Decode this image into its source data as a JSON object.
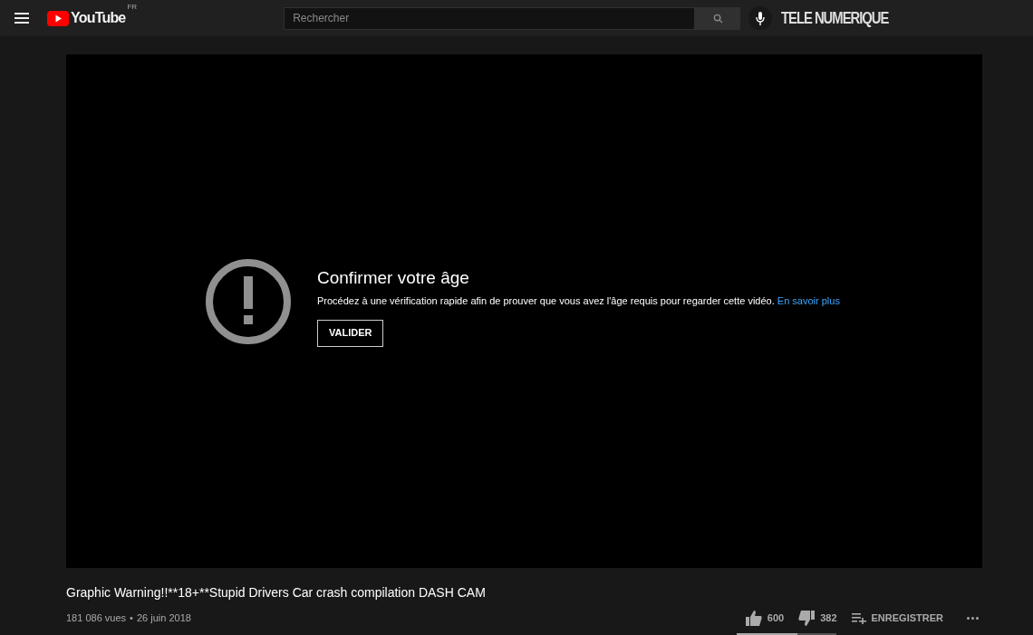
{
  "header": {
    "logo": "YouTube",
    "region": "FR",
    "search": {
      "placeholder": "Rechercher"
    },
    "channel_logo": "TELE NUMERIQUE"
  },
  "player": {
    "title": "Confirmer votre âge",
    "message": "Procédez à une vérification rapide afin de prouver que vous avez l'âge requis pour regarder cette vidéo.",
    "link": "En savoir plus",
    "button": "VALIDER"
  },
  "video": {
    "title": "Graphic Warning!!**18+**Stupid Drivers Car crash compilation DASH CAM",
    "views": "181 086 vues",
    "separator": "•",
    "date": "26 juin 2018"
  },
  "actions": {
    "likes": "600",
    "dislikes": "382",
    "save": "ENREGISTRER",
    "sentiment": {
      "level": 0.61
    }
  }
}
